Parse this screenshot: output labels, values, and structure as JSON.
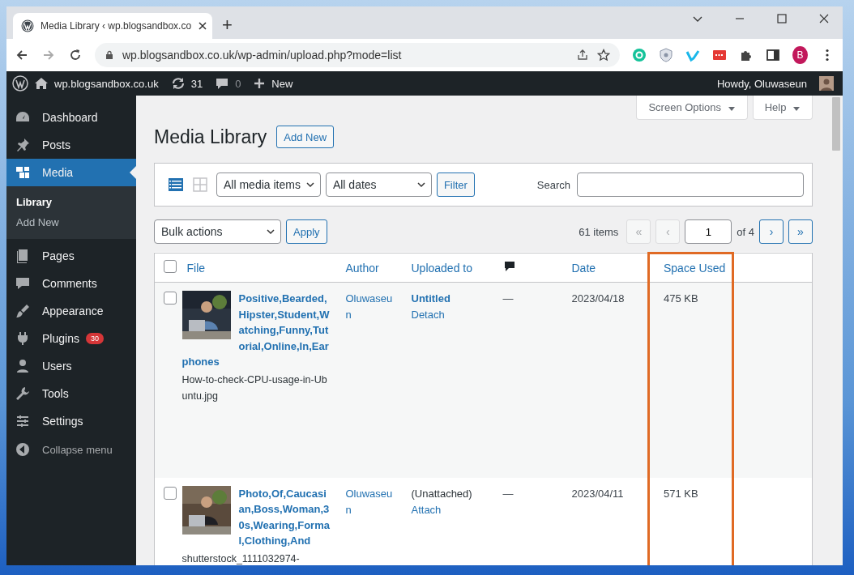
{
  "browser": {
    "tab_title": "Media Library ‹ wp.blogsandbox.co",
    "new_tab": "+",
    "url": "wp.blogsandbox.co.uk/wp-admin/upload.php?mode=list",
    "profile": "B"
  },
  "admin_bar": {
    "site": "wp.blogsandbox.co.uk",
    "updates": "31",
    "comments": "0",
    "new": "New",
    "greeting": "Howdy, Oluwaseun"
  },
  "sidebar": {
    "items": [
      {
        "label": "Dashboard",
        "selected": false
      },
      {
        "label": "Posts",
        "selected": false
      },
      {
        "label": "Media",
        "selected": true,
        "children": [
          {
            "label": "Library",
            "selected": true
          },
          {
            "label": "Add New",
            "selected": false
          }
        ]
      },
      {
        "label": "Pages",
        "selected": false
      },
      {
        "label": "Comments",
        "selected": false
      },
      {
        "label": "Appearance",
        "selected": false
      },
      {
        "label": "Plugins",
        "selected": false,
        "badge": "30"
      },
      {
        "label": "Users",
        "selected": false
      },
      {
        "label": "Tools",
        "selected": false
      },
      {
        "label": "Settings",
        "selected": false
      }
    ],
    "collapse": "Collapse menu"
  },
  "screen_options": "Screen Options",
  "help": "Help",
  "page": {
    "title": "Media Library",
    "add_new": "Add New"
  },
  "filters": {
    "view_modes": [
      {
        "kind": "list",
        "selected": true
      },
      {
        "kind": "grid",
        "selected": false
      }
    ],
    "type": "All media items",
    "dates": "All dates",
    "filter": "Filter",
    "search_label": "Search"
  },
  "bulk": {
    "action": "Bulk actions",
    "apply": "Apply"
  },
  "pagination": {
    "count": "61 items",
    "buttons": [
      {
        "label": "«",
        "disabled": true
      },
      {
        "label": "‹",
        "disabled": true
      }
    ],
    "page": "1",
    "of": "of 4",
    "next_buttons": [
      {
        "label": "›",
        "disabled": false
      },
      {
        "label": "»",
        "disabled": false
      }
    ]
  },
  "table": {
    "select_all_checked": false,
    "columns": [
      {
        "kind": "text",
        "label": "File"
      },
      {
        "kind": "text",
        "label": "Author"
      },
      {
        "kind": "text",
        "label": "Uploaded to"
      },
      {
        "kind": "comments"
      },
      {
        "kind": "text",
        "label": "Date"
      },
      {
        "kind": "text",
        "label": "Space Used",
        "highlighted": true
      }
    ],
    "rows": [
      {
        "checked": false,
        "title": "Positive,Bearded,Hipster,Student,Watching,Funny,Tutorial,Online,In,Earphones",
        "filename": "How-to-check-CPU-usage-in-Ubuntu.jpg",
        "author": "Oluwaseun",
        "uploaded_to": "Untitled",
        "attached": true,
        "action": "Detach",
        "comments": "—",
        "date": "2023/04/18",
        "space": "475 KB"
      },
      {
        "checked": false,
        "title": "Photo,Of,Caucasian,Boss,Woman,30s,Wearing,Formal,Clothing,And",
        "filename": "shutterstock_1111032974-",
        "author": "Oluwaseun",
        "uploaded_to": "(Unattached)",
        "attached": false,
        "action": "Attach",
        "comments": "—",
        "date": "2023/04/11",
        "space": "571 KB"
      }
    ]
  }
}
